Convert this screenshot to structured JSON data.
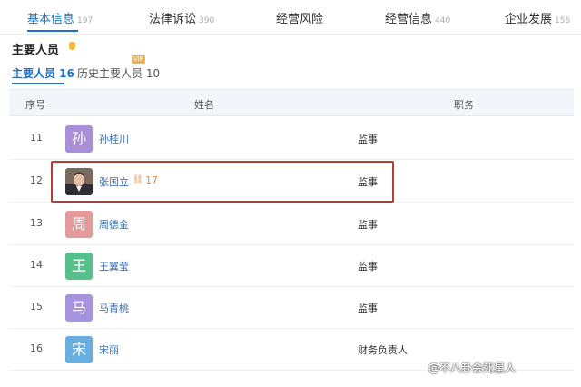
{
  "tabs": [
    {
      "label": "基本信息",
      "count": "197"
    },
    {
      "label": "法律诉讼",
      "count": "390"
    },
    {
      "label": "经营风险",
      "count": ""
    },
    {
      "label": "经营信息",
      "count": "440"
    },
    {
      "label": "企业发展",
      "count": "156"
    }
  ],
  "section": {
    "title": "主要人员"
  },
  "subtabs": {
    "current": "主要人员 16",
    "history": "历史主要人员 10",
    "vip": "VIP"
  },
  "table": {
    "headers": {
      "index": "序号",
      "name": "姓名",
      "position": "职务"
    },
    "rows": [
      {
        "index": "11",
        "avatar_char": "孙",
        "avatar_color": "#a98fd6",
        "name": "孙桂川",
        "position": "监事"
      },
      {
        "index": "12",
        "avatar_char": "",
        "avatar_color": "",
        "name": "张国立",
        "position": "监事",
        "related_count": "17"
      },
      {
        "index": "13",
        "avatar_char": "周",
        "avatar_color": "#e39a9a",
        "name": "周德金",
        "position": "监事"
      },
      {
        "index": "14",
        "avatar_char": "王",
        "avatar_color": "#59c08d",
        "name": "王翼莹",
        "position": "监事"
      },
      {
        "index": "15",
        "avatar_char": "马",
        "avatar_color": "#a693dd",
        "name": "马青桃",
        "position": "监事"
      },
      {
        "index": "16",
        "avatar_char": "宋",
        "avatar_color": "#6aaee0",
        "name": "宋丽",
        "position": "财务负责人"
      }
    ]
  },
  "watermark": "@不八卦会死星人",
  "colors": {
    "accent": "#1a73c8",
    "highlight_border": "#b63a35"
  }
}
